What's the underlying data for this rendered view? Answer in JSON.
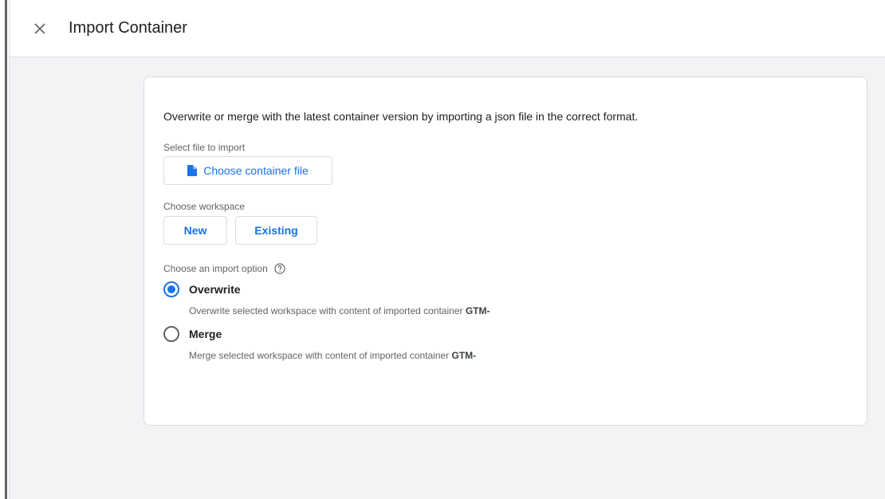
{
  "header": {
    "title": "Import Container"
  },
  "intro": "Overwrite or merge with the latest container version by importing a json file in the correct format.",
  "select_file": {
    "label": "Select file to import",
    "button_label": "Choose container file"
  },
  "workspace": {
    "label": "Choose workspace",
    "new_label": "New",
    "existing_label": "Existing"
  },
  "import_option": {
    "label": "Choose an import option",
    "options": [
      {
        "label": "Overwrite",
        "description": "Overwrite selected workspace with content of imported container ",
        "container_id": "GTM-",
        "selected": true
      },
      {
        "label": "Merge",
        "description": "Merge selected workspace with content of imported container ",
        "container_id": "GTM-",
        "selected": false
      }
    ]
  },
  "colors": {
    "accent": "#1a73e8",
    "background": "#f1f3f4",
    "border": "#dadce0"
  },
  "icons": {
    "close": "close-icon",
    "file": "file-icon",
    "help": "help-icon"
  }
}
